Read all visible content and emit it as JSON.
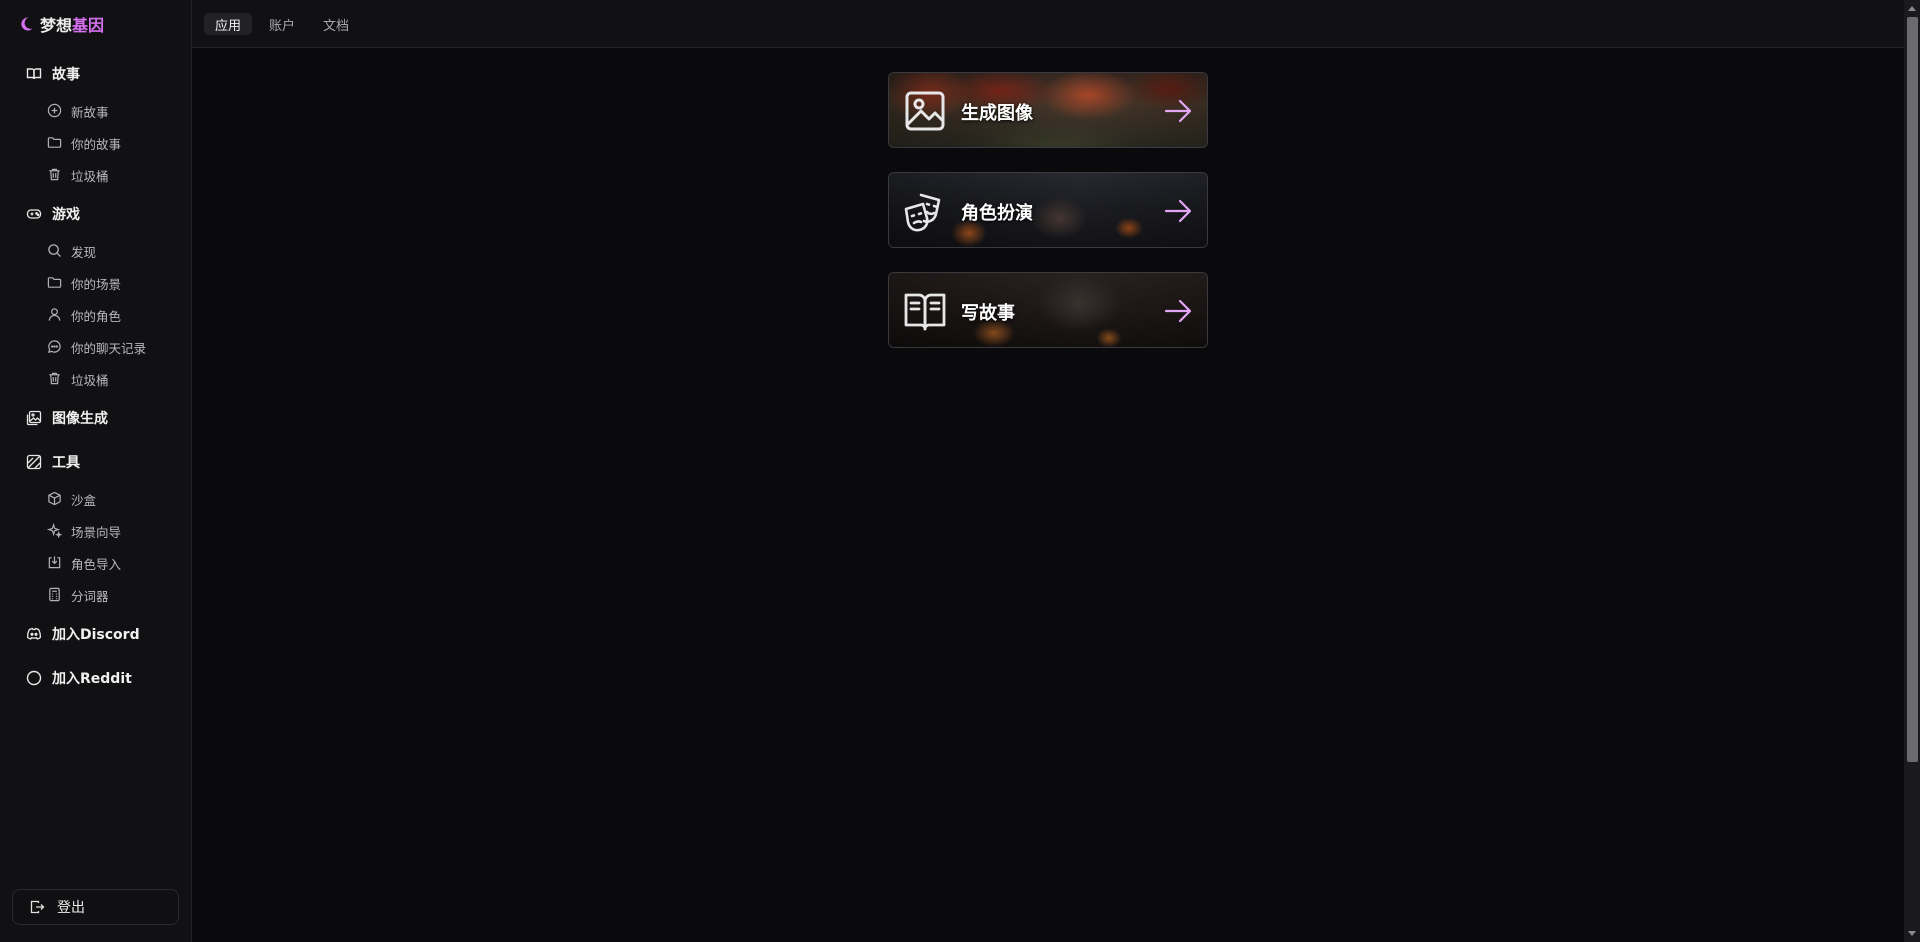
{
  "brand": {
    "name_part1": "梦想",
    "name_part2": "基因",
    "logo_icon": "moon-icon"
  },
  "sidebar": {
    "sections": [
      {
        "label": "故事",
        "icon": "book-open-icon",
        "items": [
          {
            "label": "新故事",
            "icon": "plus-circle-icon"
          },
          {
            "label": "你的故事",
            "icon": "folder-icon"
          },
          {
            "label": "垃圾桶",
            "icon": "trash-icon"
          }
        ]
      },
      {
        "label": "游戏",
        "icon": "gamepad-icon",
        "items": [
          {
            "label": "发现",
            "icon": "search-icon"
          },
          {
            "label": "你的场景",
            "icon": "folder-icon"
          },
          {
            "label": "你的角色",
            "icon": "user-icon"
          },
          {
            "label": "你的聊天记录",
            "icon": "chat-bubble-icon"
          },
          {
            "label": "垃圾桶",
            "icon": "trash-icon"
          }
        ]
      },
      {
        "label": "图像生成",
        "icon": "images-icon",
        "items": []
      },
      {
        "label": "工具",
        "icon": "tools-icon",
        "items": [
          {
            "label": "沙盒",
            "icon": "box-icon"
          },
          {
            "label": "场景向导",
            "icon": "sparkles-icon"
          },
          {
            "label": "角色导入",
            "icon": "import-icon"
          },
          {
            "label": "分词器",
            "icon": "calculator-icon"
          }
        ]
      },
      {
        "label": "加入Discord",
        "icon": "discord-icon",
        "items": []
      },
      {
        "label": "加入Reddit",
        "icon": "reddit-icon",
        "items": []
      }
    ],
    "logout_label": "登出"
  },
  "header": {
    "tabs": [
      {
        "label": "应用",
        "active": true
      },
      {
        "label": "账户",
        "active": false
      },
      {
        "label": "文档",
        "active": false
      }
    ]
  },
  "cards": [
    {
      "title": "生成图像",
      "icon": "image-icon"
    },
    {
      "title": "角色扮演",
      "icon": "theater-masks-icon"
    },
    {
      "title": "写故事",
      "icon": "open-book-icon"
    }
  ],
  "colors": {
    "accent": "#d670f0",
    "arrow": "#e3a6f5",
    "background": "#0a0a0c",
    "sidebar": "#111113"
  }
}
